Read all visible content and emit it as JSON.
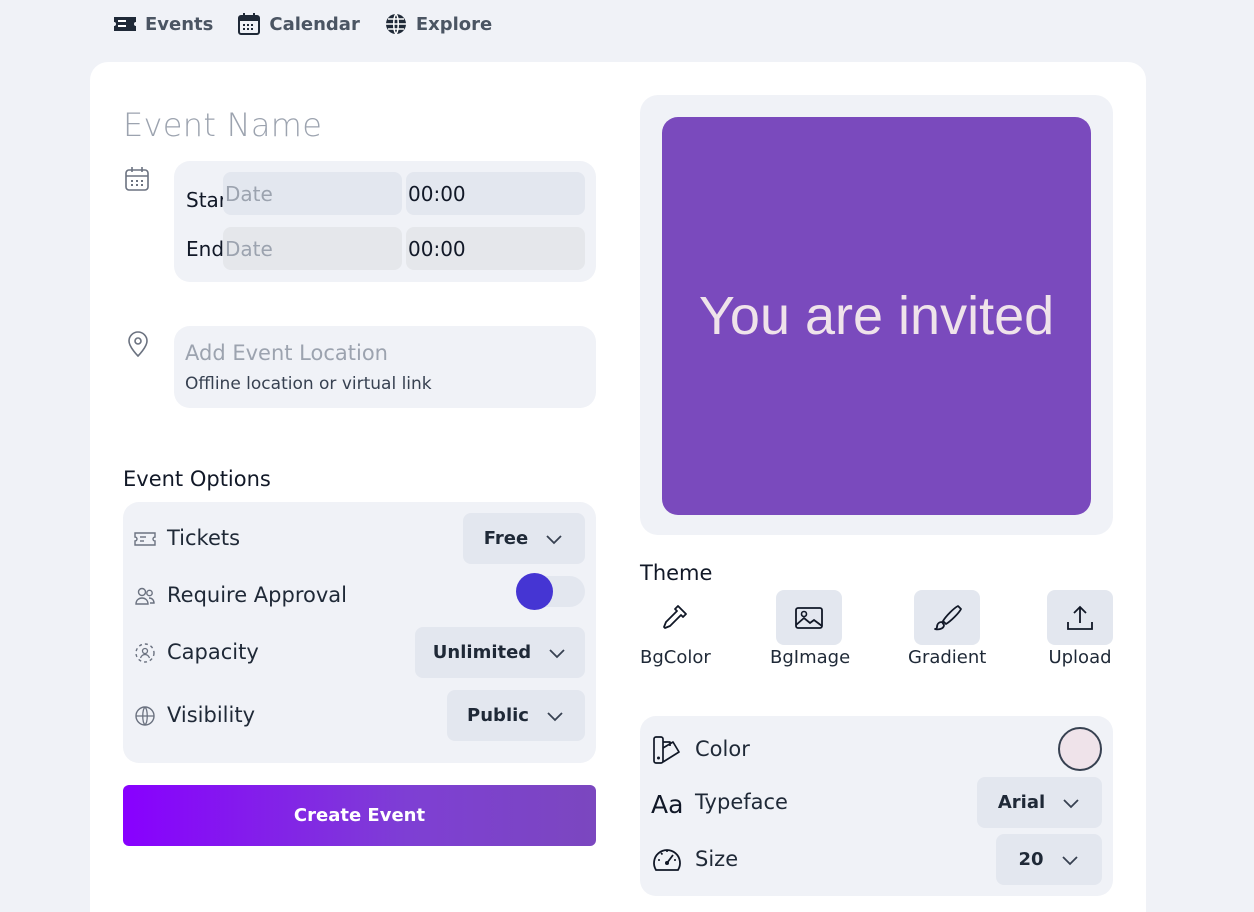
{
  "nav": {
    "items": [
      {
        "label": "Events",
        "icon": "ticket-icon"
      },
      {
        "label": "Calendar",
        "icon": "calendar-icon"
      },
      {
        "label": "Explore",
        "icon": "globe-icon"
      }
    ]
  },
  "form": {
    "event_name_placeholder": "Event Name",
    "start_label": "Star",
    "end_label": "End",
    "start_date_placeholder": "Date",
    "start_time": "00:00",
    "end_date_placeholder": "Date",
    "end_time": "00:00",
    "location_placeholder": "Add Event Location",
    "location_hint": "Offline location or virtual link"
  },
  "options": {
    "title": "Event Options",
    "tickets": {
      "label": "Tickets",
      "value": "Free"
    },
    "approval": {
      "label": "Require Approval",
      "enabled": true
    },
    "capacity": {
      "label": "Capacity",
      "value": "Unlimited"
    },
    "visibility": {
      "label": "Visibility",
      "value": "Public"
    }
  },
  "create_button": "Create Event",
  "preview": {
    "text": "You are invited",
    "bg_color": "#7a4abd",
    "text_color": "#efe3ea"
  },
  "theme": {
    "title": "Theme",
    "buttons": [
      {
        "label": "BgColor",
        "icon": "eyedropper-icon"
      },
      {
        "label": "BgImage",
        "icon": "image-icon"
      },
      {
        "label": "Gradient",
        "icon": "brush-icon"
      },
      {
        "label": "Upload",
        "icon": "upload-icon"
      }
    ]
  },
  "style": {
    "color_label": "Color",
    "color_value": "#efe3ea",
    "typeface_label": "Typeface",
    "typeface_value": "Arial",
    "size_label": "Size",
    "size_value": "20"
  },
  "colors": {
    "accent": "#4535d3",
    "button_gradient_start": "#8800ff",
    "button_gradient_end": "#7b47bf",
    "panel_bg": "#f0f2f7"
  }
}
